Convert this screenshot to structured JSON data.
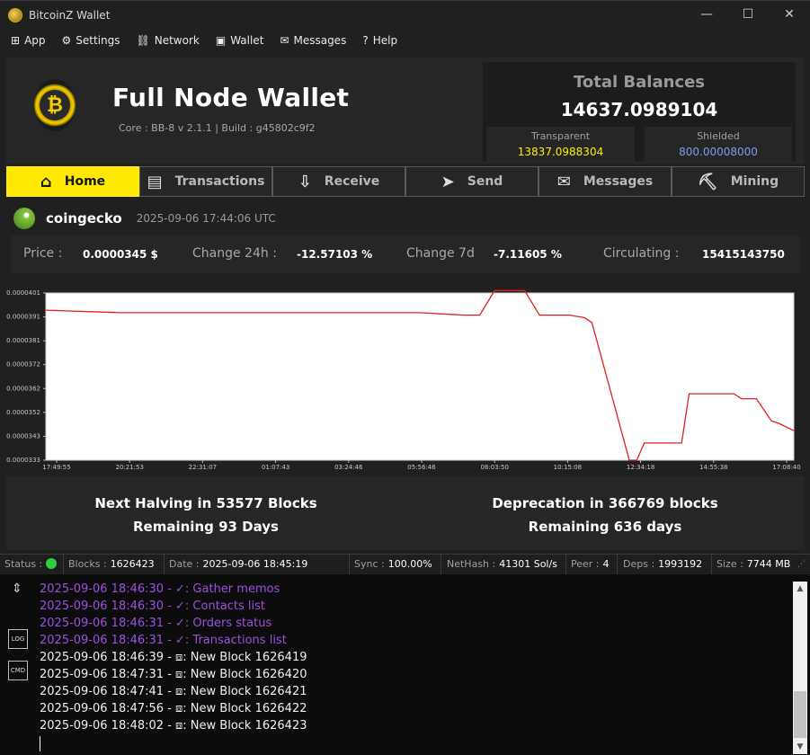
{
  "window": {
    "title": "BitcoinZ Wallet",
    "minimize": "—",
    "maximize": "☐",
    "close": "✕"
  },
  "menu": [
    {
      "label": "App",
      "icon": "⊞"
    },
    {
      "label": "Settings",
      "icon": "⚙"
    },
    {
      "label": "Network",
      "icon": "⛓"
    },
    {
      "label": "Wallet",
      "icon": "▣"
    },
    {
      "label": "Messages",
      "icon": "✉"
    },
    {
      "label": "Help",
      "icon": "?"
    }
  ],
  "header": {
    "title": "Full Node Wallet",
    "core": "Core : BB-8 v 2.1.1 | Build : g45802c9f2",
    "logo_glyph": "₿"
  },
  "balances": {
    "title": "Total Balances",
    "total": "14637.0989104",
    "transparent_label": "Transparent",
    "transparent_value": "13837.0988304",
    "shielded_label": "Shielded",
    "shielded_value": "800.00008000",
    "transparent_color": "#fff200",
    "shielded_color": "#7e9cf0"
  },
  "tabs": [
    {
      "label": "Home",
      "icon": "⌂"
    },
    {
      "label": "Transactions",
      "icon": "▤"
    },
    {
      "label": "Receive",
      "icon": "⇩"
    },
    {
      "label": "Send",
      "icon": "➤"
    },
    {
      "label": "Messages",
      "icon": "✉"
    },
    {
      "label": "Mining",
      "icon": "⛏"
    }
  ],
  "coingecko": {
    "name": "coingecko",
    "timestamp": "2025-09-06 17:44:06 UTC",
    "price_label": "Price :",
    "price_value": "0.0000345 $",
    "change24_label": "Change 24h :",
    "change24_value": "-12.57103 %",
    "change7_label": "Change 7d",
    "change7_value": "-7.11605 %",
    "circ_label": "Circulating :",
    "circ_value": "15415143750"
  },
  "chart_data": {
    "type": "line",
    "title": "",
    "xlabel": "",
    "ylabel": "",
    "y_ticks": [
      "0.0000401",
      "0.0000391",
      "0.0000381",
      "0.0000372",
      "0.0000362",
      "0.0000352",
      "0.0000343",
      "0.0000333"
    ],
    "x_ticks": [
      "17:49:55",
      "20:21:53",
      "22:31:07",
      "01:07:43",
      "03:24:46",
      "05:56:46",
      "08:03:50",
      "10:15:08",
      "12:34:18",
      "14:55:38",
      "17:08:40"
    ],
    "ylim": [
      3.33e-05,
      4.01e-05
    ],
    "grid": false,
    "line_color": "#e02020",
    "series": [
      {
        "x": [
          0,
          0.1,
          0.2,
          0.3,
          0.4,
          0.5,
          0.56,
          0.58,
          0.6,
          0.62,
          0.64,
          0.66,
          0.69,
          0.7,
          0.72,
          0.73,
          0.78,
          0.79,
          0.8,
          0.85,
          0.86,
          0.92,
          0.93,
          0.95,
          0.97,
          0.98,
          1.0
        ],
        "values": [
          3.94e-05,
          3.93e-05,
          3.93e-05,
          3.93e-05,
          3.93e-05,
          3.93e-05,
          3.92e-05,
          3.92e-05,
          4.02e-05,
          4.02e-05,
          4.02e-05,
          3.92e-05,
          3.92e-05,
          3.92e-05,
          3.91e-05,
          3.89e-05,
          3.33e-05,
          3.33e-05,
          3.4e-05,
          3.4e-05,
          3.6e-05,
          3.6e-05,
          3.58e-05,
          3.58e-05,
          3.49e-05,
          3.48e-05,
          3.45e-05
        ]
      }
    ]
  },
  "halving": {
    "next": "Next Halving in 53577 Blocks",
    "remaining": "Remaining 93 Days",
    "deprecation": "Deprecation in 366769 blocks",
    "dep_remaining": "Remaining 636 days"
  },
  "status": {
    "status_label": "Status :",
    "blocks_label": "Blocks :",
    "blocks": "1626423",
    "date_label": "Date :",
    "date": "2025-09-06 18:45:19",
    "sync_label": "Sync :",
    "sync": "100.00%",
    "nethash_label": "NetHash :",
    "nethash": "41301 Sol/s",
    "peer_label": "Peer :",
    "peer": "4",
    "deps_label": "Deps :",
    "deps": "1993192",
    "size_label": "Size :",
    "size": "7744 MB"
  },
  "log": {
    "log_icon": "LOG",
    "cmd_icon": "CMD",
    "lines": [
      "2025-09-06 18:46:30 - ✓: Gather memos",
      "2025-09-06 18:46:30 - ✓: Contacts list",
      "2025-09-06 18:46:31 - ✓: Orders status",
      "2025-09-06 18:46:31 - ✓: Transactions list",
      "2025-09-06 18:46:39 - ⧈: New Block 1626419",
      "2025-09-06 18:47:31 - ⧈: New Block 1626420",
      "2025-09-06 18:47:41 - ⧈: New Block 1626421",
      "2025-09-06 18:47:56 - ⧈: New Block 1626422",
      "2025-09-06 18:48:02 - ⧈: New Block 1626423"
    ]
  }
}
